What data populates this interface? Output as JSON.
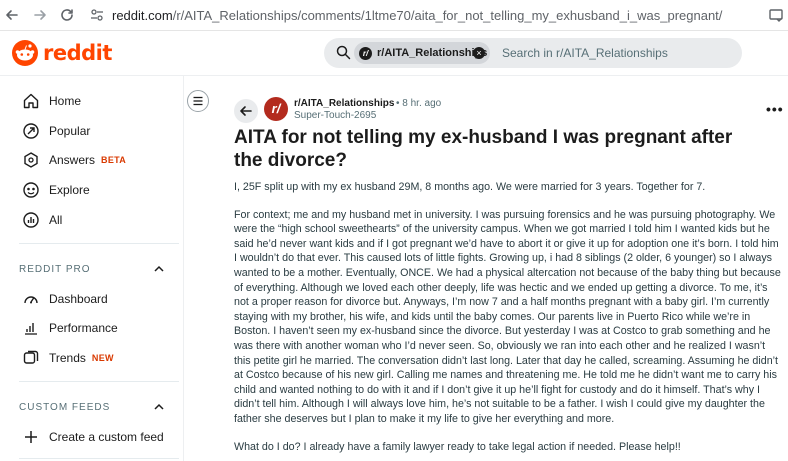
{
  "browser": {
    "url_host": "reddit.com",
    "url_path": "/r/AITA_Relationships/comments/1ltme70/aita_for_not_telling_my_exhusband_i_was_pregnant/"
  },
  "header": {
    "logo_text": "reddit",
    "search": {
      "chip_label": "r/AITA_Relationships",
      "chip_icon": "r/",
      "placeholder": "Search in r/AITA_Relationships"
    }
  },
  "sidebar": {
    "items": [
      {
        "label": "Home",
        "icon": "home-icon"
      },
      {
        "label": "Popular",
        "icon": "popular-icon"
      },
      {
        "label": "Answers",
        "icon": "answers-icon",
        "badge": "BETA"
      },
      {
        "label": "Explore",
        "icon": "explore-icon"
      },
      {
        "label": "All",
        "icon": "all-icon"
      }
    ],
    "reddit_pro": {
      "heading": "REDDIT PRO",
      "items": [
        {
          "label": "Dashboard",
          "icon": "dashboard-icon"
        },
        {
          "label": "Performance",
          "icon": "performance-icon"
        },
        {
          "label": "Trends",
          "icon": "trends-icon",
          "badge": "NEW"
        }
      ]
    },
    "custom_feeds": {
      "heading": "CUSTOM FEEDS",
      "items": [
        {
          "label": "Create a custom feed",
          "icon": "plus-icon"
        }
      ]
    }
  },
  "post": {
    "subreddit": "r/AITA_Relationships",
    "subreddit_icon": "r/",
    "time": "• 8 hr. ago",
    "author": "Super-Touch-2695",
    "more": "•••",
    "title": "AITA for not telling my ex-husband I was pregnant after the divorce?",
    "paragraphs": [
      "I, 25F split up with my ex husband 29M, 8 months ago. We were married for 3 years. Together for 7.",
      "For context; me and my husband met in university. I was pursuing forensics and he was pursuing photography. We were the “high school sweethearts” of the university campus. When we got married I told him I wanted kids but he said he’d never want kids and if I got pregnant we’d have to abort it or give it up for adoption one it’s born. I told him I wouldn’t do that ever. This caused lots of little fights. Growing up, i had 8 siblings (2 older, 6 younger) so I always wanted to be a mother. Eventually, ONCE. We had a physical altercation not because of the baby thing but because of everything. Although we loved each other deeply, life was hectic and we ended up getting a divorce. To me, it’s not a proper reason for divorce but. Anyways, I’m now 7 and a half months pregnant with a baby girl. I’m currently staying with my brother, his wife, and kids until the baby comes. Our parents live in Puerto Rico while we’re in Boston. I haven’t seen my ex-husband since the divorce. But yesterday I was at Costco to grab something and he was there with another woman who I’d never seen. So, obviously we ran into each other and he realized I wasn’t this petite girl he married. The conversation didn’t last long. Later that day he called, screaming. Assuming he didn’t at Costco because of his new girl. Calling me names and threatening me. He told me he didn’t want me to carry his child and wanted nothing to do with it and if I don’t give it up he’ll fight for custody and do it himself. That’s why I didn’t tell him. Although I will always love him, he’s not suitable to be a father. I wish I could give my daughter the father she deserves but I plan to make it my life to give her everything and more.",
      "What do I do? I already have a family lawyer ready to take legal action if needed. Please help!!"
    ]
  },
  "colors": {
    "brand": "#ff4500",
    "badge": "#d93900",
    "sub_avatar": "#b32b1e",
    "search_bg": "#e9ebed"
  }
}
